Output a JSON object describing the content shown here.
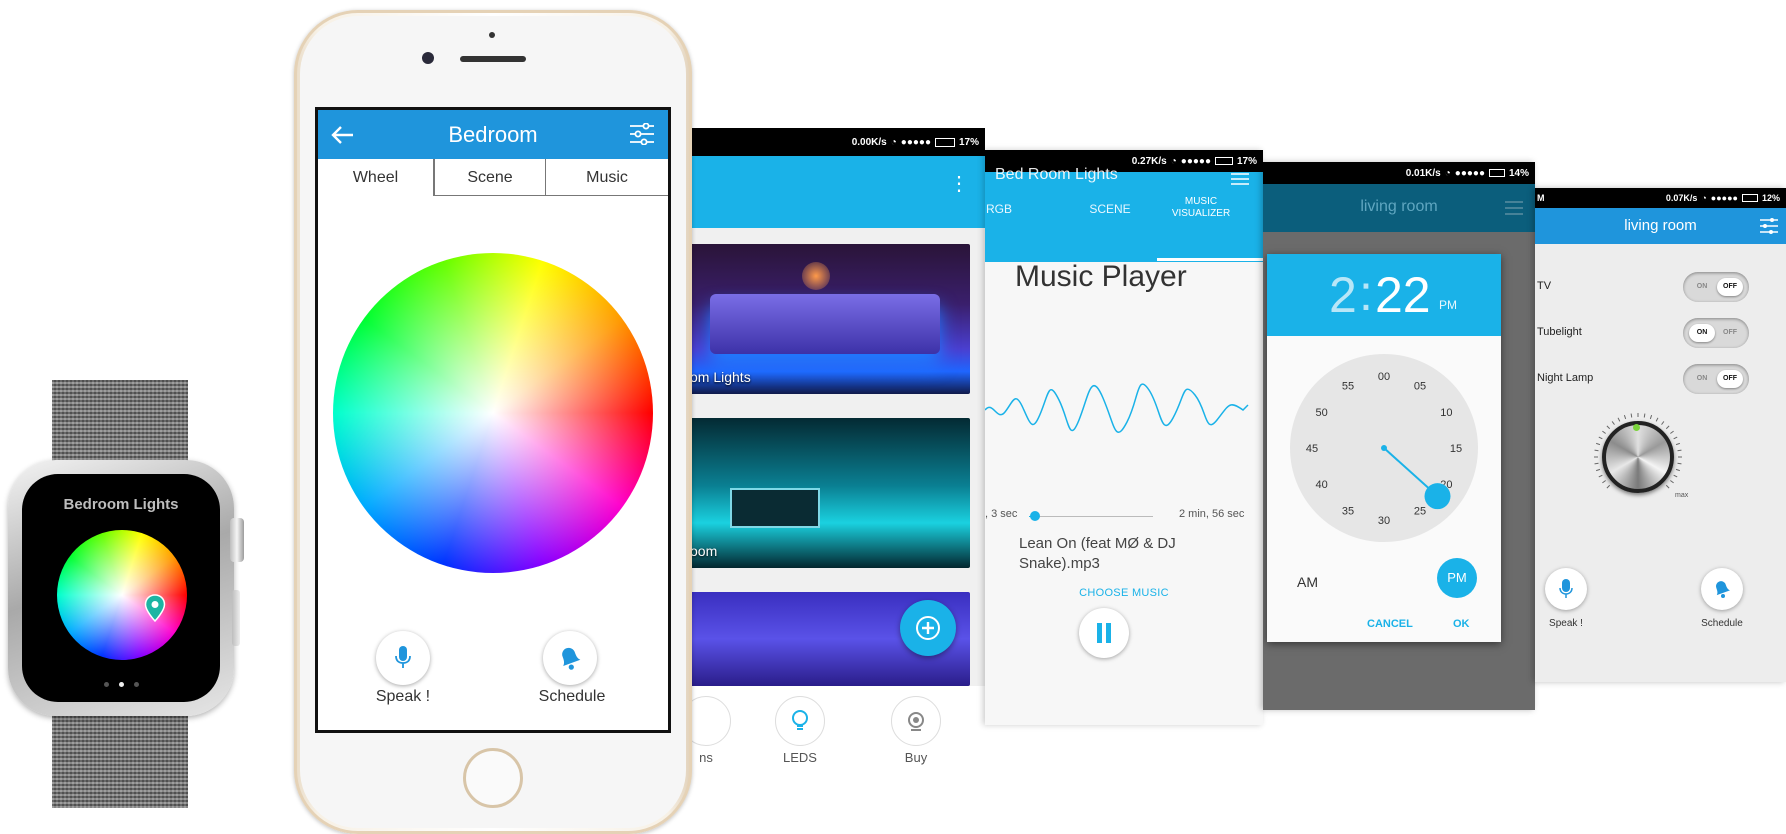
{
  "watch": {
    "title": "Bedroom Lights",
    "page_dots": 3,
    "active_dot": 1
  },
  "iphone": {
    "header_title": "Bedroom",
    "tabs": [
      "Wheel",
      "Scene",
      "Music"
    ],
    "active_tab": 0,
    "speak_label": "Speak !",
    "schedule_label": "Schedule"
  },
  "screen_list": {
    "status": {
      "speed": "0.00K/s",
      "battery": "17%"
    },
    "cards": [
      {
        "label": "om Lights"
      },
      {
        "label": "oom"
      },
      {
        "label": ""
      }
    ],
    "bottom_nav": [
      "ns",
      "LEDS",
      "Buy"
    ]
  },
  "screen_music": {
    "status": {
      "speed": "0.27K/s",
      "battery": "17%"
    },
    "header_title": "Bed Room Lights",
    "tabs": [
      "RGB",
      "SCENE",
      "MUSIC VISUALIZER"
    ],
    "active_tab": 2,
    "player_title": "Music Player",
    "time_elapsed": ", 3 sec",
    "time_total": "2 min, 56 sec",
    "progress": 0.05,
    "track_name": "Lean On (feat MØ & DJ Snake).mp3",
    "choose_music": "CHOOSE MUSIC"
  },
  "screen_clock": {
    "status": {
      "speed": "0.01K/s",
      "battery": "14%"
    },
    "header_title": "living room",
    "time_hour": "2",
    "time_colon": ":",
    "time_minutes": "22",
    "time_ampm": "PM",
    "clock_numbers": [
      "00",
      "05",
      "10",
      "15",
      "20",
      "25",
      "30",
      "35",
      "40",
      "45",
      "50",
      "55"
    ],
    "selected_minute": 22,
    "am_label": "AM",
    "pm_label": "PM",
    "cancel_label": "CANCEL",
    "ok_label": "OK"
  },
  "screen_switches": {
    "status": {
      "speed": "0.07K/s",
      "battery": "12%",
      "carrier": "M"
    },
    "header_title": "living room",
    "devices": [
      {
        "name": "TV",
        "state": "OFF"
      },
      {
        "name": "Tubelight",
        "state": "ON"
      },
      {
        "name": "Night Lamp",
        "state": "OFF"
      }
    ],
    "switch_on": "ON",
    "switch_off": "OFF",
    "knob_max": "max",
    "speak_label": "Speak !",
    "schedule_label": "Schedule"
  },
  "colors": {
    "blue_header": "#1f95dc",
    "cyan_accent": "#1ab2e8",
    "list_header": "#1ab2e8"
  }
}
